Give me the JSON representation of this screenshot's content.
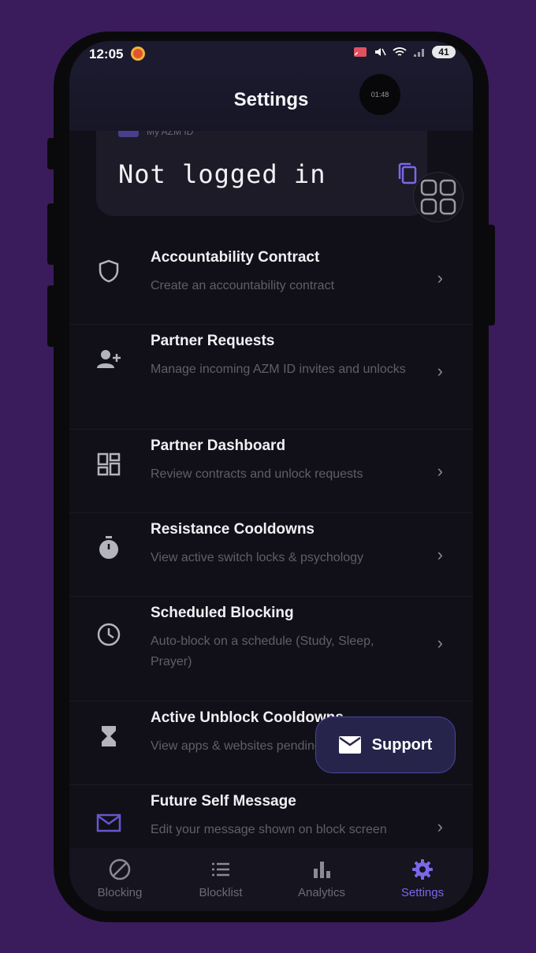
{
  "status_bar": {
    "time": "12:05",
    "battery": "41"
  },
  "header": {
    "title": "Settings",
    "timer_text": "01:48"
  },
  "id_card": {
    "label": "My AZM ID",
    "value": "Not logged in"
  },
  "settings_items": [
    {
      "title": "Accountability Contract",
      "subtitle": "Create an accountability contract",
      "icon": "shield-icon"
    },
    {
      "title": "Partner Requests",
      "subtitle": "Manage incoming AZM ID invites and unlocks",
      "icon": "person-add-icon"
    },
    {
      "title": "Partner Dashboard",
      "subtitle": "Review contracts and unlock requests",
      "icon": "dashboard-icon"
    },
    {
      "title": "Resistance Cooldowns",
      "subtitle": "View active switch locks & psychology",
      "icon": "stopwatch-icon"
    },
    {
      "title": "Scheduled Blocking",
      "subtitle": "Auto-block on a schedule (Study, Sleep, Prayer)",
      "icon": "clock-icon"
    },
    {
      "title": "Active Unblock Cooldowns",
      "subtitle": "View apps & websites pending unblock",
      "icon": "hourglass-icon"
    },
    {
      "title": "Future Self Message",
      "subtitle": "Edit your message shown on block screen",
      "icon": "mail-icon"
    }
  ],
  "support_button": {
    "label": "Support",
    "icon": "mail-icon"
  },
  "bottom_nav": [
    {
      "label": "Blocking",
      "icon": "block-icon",
      "active": false
    },
    {
      "label": "Blocklist",
      "icon": "list-icon",
      "active": false
    },
    {
      "label": "Analytics",
      "icon": "bar-chart-icon",
      "active": false
    },
    {
      "label": "Settings",
      "icon": "gear-icon",
      "active": true
    }
  ],
  "colors": {
    "accent": "#7a68e8",
    "background": "#3a1c5c",
    "screen": "#111018"
  }
}
